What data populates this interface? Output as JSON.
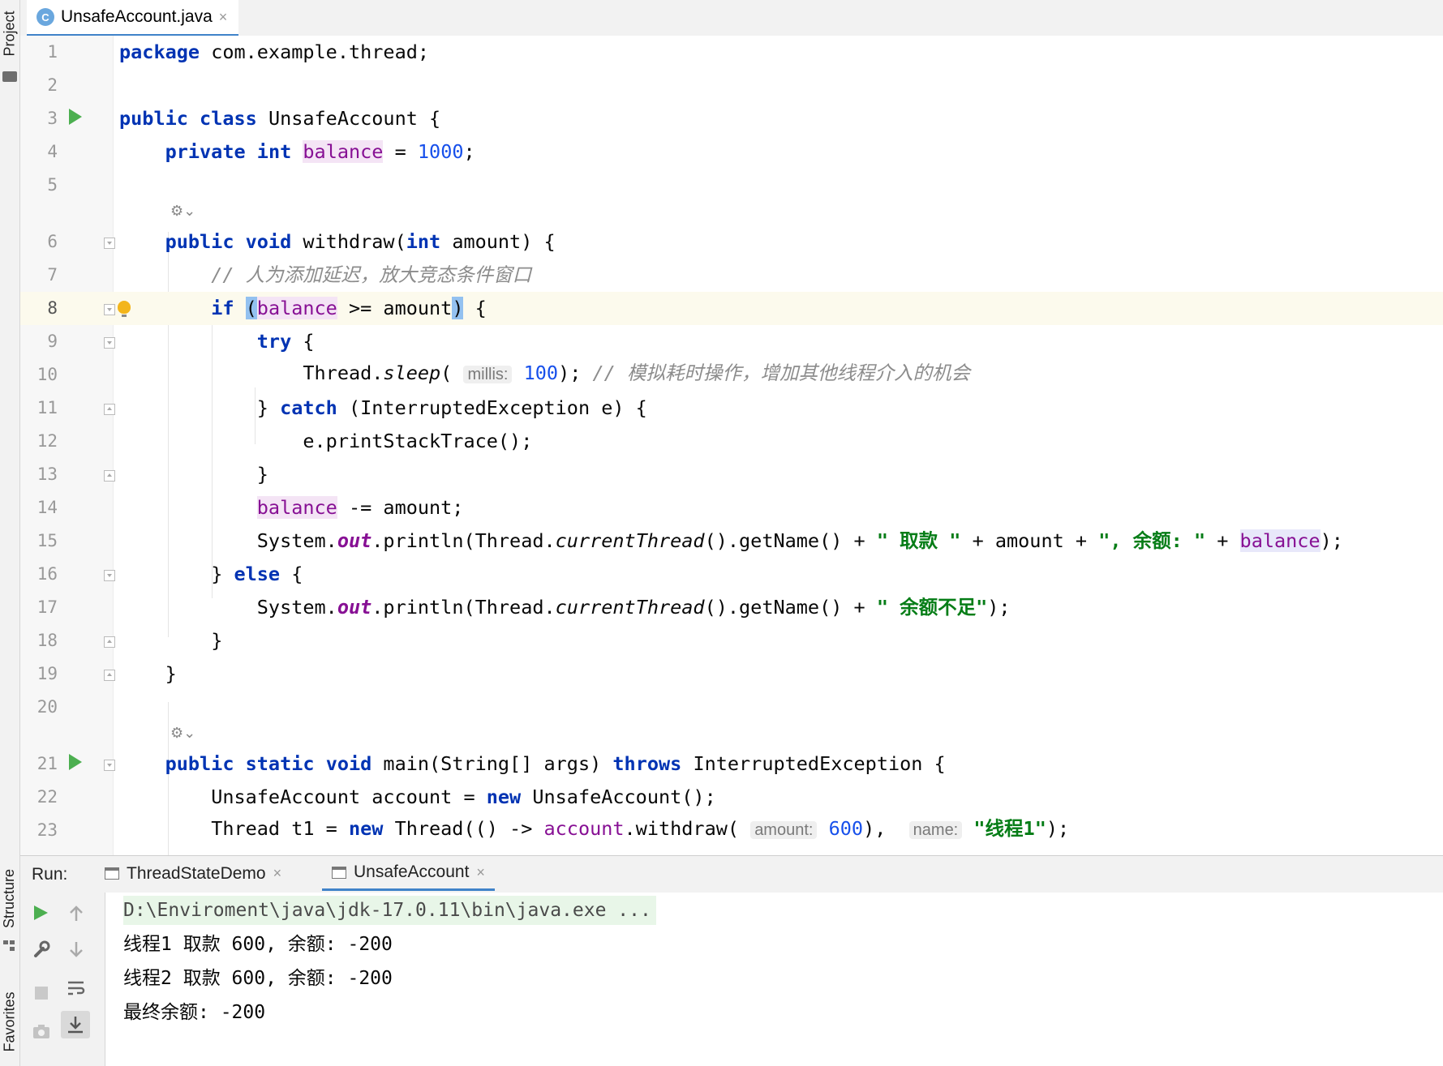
{
  "sidebar": {
    "project_label": "Project",
    "structure_label": "Structure",
    "favorites_label": "Favorites"
  },
  "editor_tab": {
    "file_name": "UnsafeAccount.java",
    "icon_letter": "C",
    "close": "×"
  },
  "code": {
    "l1": "1",
    "l2": "2",
    "l3": "3",
    "l4": "4",
    "l5": "5",
    "l6": "6",
    "l7": "7",
    "l8": "8",
    "l9": "9",
    "l10": "10",
    "l11": "11",
    "l12": "12",
    "l13": "13",
    "l14": "14",
    "l15": "15",
    "l16": "16",
    "l17": "17",
    "l18": "18",
    "l19": "19",
    "l20": "20",
    "l21": "21",
    "l22": "22",
    "l23": "23",
    "kw_package": "package",
    "pkg_name": " com.example.thread;",
    "kw_public": "public",
    "kw_class": "class",
    "class_decl": " UnsafeAccount {",
    "kw_private": "private",
    "kw_int": "int",
    "f_balance": "balance",
    "assign": " = ",
    "n_1000": "1000",
    "semi": ";",
    "kw_void": "void",
    "withdraw_sig": " withdraw(",
    "amount_param": " amount) {",
    "comment_delay": "// 人为添加延迟，放大竞态条件窗口",
    "kw_if": "if",
    "paren_open": "(",
    "cmp_amount": " >= amount",
    "paren_close": ")",
    "brace_open": " {",
    "kw_try": "try",
    "thread_prefix": "Thread.",
    "m_sleep": "sleep",
    "hint_millis": "millis:",
    "n_100": "100",
    "close_semi": "); ",
    "comment_sleep": "// 模拟耗时操作，增加其他线程介入的机会",
    "brace_close_sp": "} ",
    "kw_catch": "catch",
    "catch_rest": " (InterruptedException e) {",
    "print_trace": "e.printStackTrace();",
    "brace_close": "}",
    "minus_amount": " -= amount;",
    "system_prefix": "System.",
    "f_out": "out",
    "println_thread": ".println(Thread.",
    "m_current": "currentThread",
    "get_name_plus": "().getName() + ",
    "s_withdraw": "\" 取款 \"",
    "plus_amount_plus": " + amount + ",
    "s_balance_label": "\", 余额: \"",
    "plus": " + ",
    "close_paren_semi": ");",
    "kw_else": "else",
    "s_insufficient": "\" 余额不足\"",
    "kw_static": "static",
    "main_sig": " main(String[] args) ",
    "kw_throws": "throws",
    "main_rest": " InterruptedException {",
    "account_decl": "UnsafeAccount account = ",
    "kw_new": "new",
    "new_account": " UnsafeAccount();",
    "thread_t1": "Thread t1 = ",
    "thread_lambda": " Thread(() -> ",
    "v_account": "account",
    "withdraw_call": ".withdraw( ",
    "hint_amount": "amount:",
    "n_600": "600",
    "comma": "),  ",
    "hint_name": "name:",
    "s_thread1": "\"线程1\"",
    "tail_t1": ");",
    "lens_icon": "⚙⌄"
  },
  "run_panel": {
    "label": "Run:",
    "tabs": [
      {
        "label": "ThreadStateDemo",
        "close": "×"
      },
      {
        "label": "UnsafeAccount",
        "close": "×"
      }
    ],
    "console_lines": [
      "D:\\Enviroment\\java\\jdk-17.0.11\\bin\\java.exe ...",
      "线程1 取款 600, 余额: -200",
      "线程2 取款 600, 余额: -200",
      "最终余额: -200"
    ]
  },
  "colors": {
    "keyword": "#0033b3",
    "number": "#1750eb",
    "string": "#067d17",
    "comment": "#8c8c8c",
    "field": "#871094",
    "current_line": "#fcfaed",
    "run_green": "#4caf50"
  }
}
